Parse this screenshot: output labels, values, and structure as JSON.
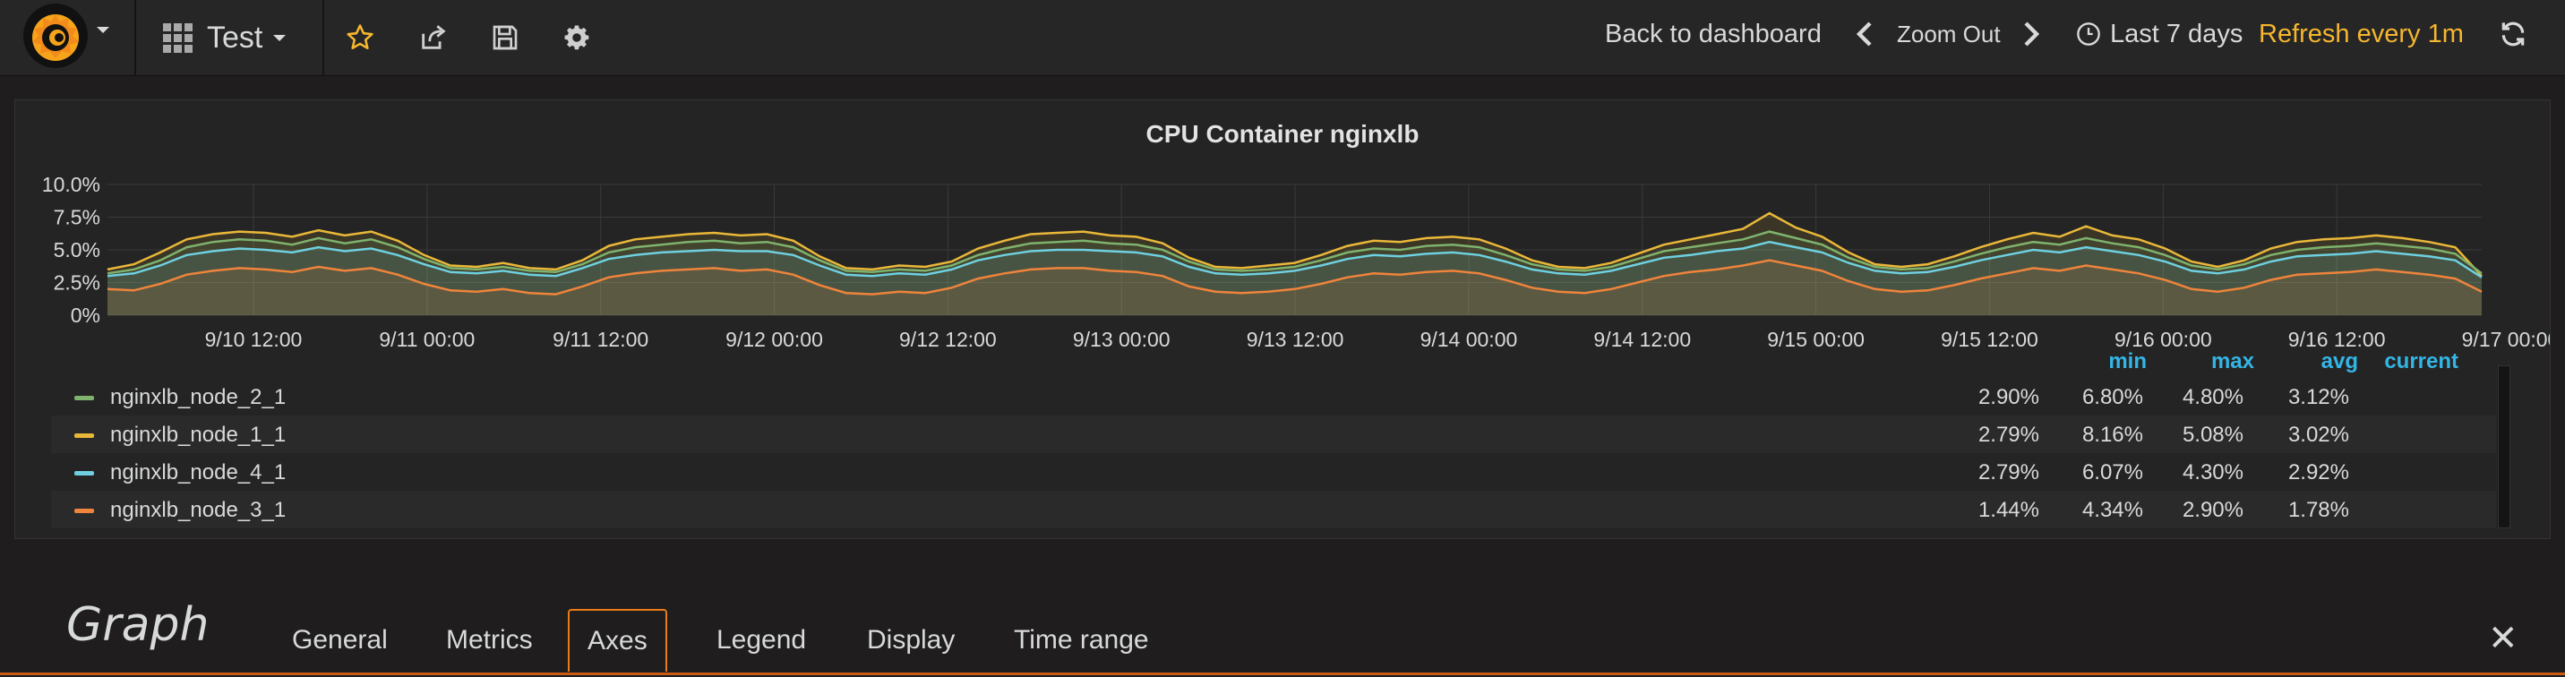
{
  "navbar": {
    "dashboard_title": "Test",
    "back_to_dashboard": "Back to dashboard",
    "zoom_out": "Zoom Out",
    "time_range": "Last 7 days",
    "refresh": "Refresh every 1m"
  },
  "panel": {
    "title": "CPU Container nginxlb"
  },
  "chart_data": {
    "type": "area",
    "title": "CPU Container nginxlb",
    "y_ticks": [
      "10.0%",
      "7.5%",
      "5.0%",
      "2.5%",
      "0%"
    ],
    "ylim": [
      0,
      10
    ],
    "x_ticks": [
      "9/10 12:00",
      "9/11 00:00",
      "9/11 12:00",
      "9/12 00:00",
      "9/12 12:00",
      "9/13 00:00",
      "9/13 12:00",
      "9/14 00:00",
      "9/14 12:00",
      "9/15 00:00",
      "9/15 12:00",
      "9/16 00:00",
      "9/16 12:00",
      "9/17 00:00"
    ],
    "grid": true,
    "legend_position": "bottom",
    "legend_columns": [
      "min",
      "max",
      "avg",
      "current"
    ],
    "series": [
      {
        "name": "nginxlb_node_2_1",
        "color": "#7eb26d",
        "min": "2.90%",
        "max": "6.80%",
        "avg": "4.80%",
        "current": "3.12%",
        "values": [
          3.2,
          3.5,
          4.2,
          5.2,
          5.6,
          5.8,
          5.7,
          5.4,
          5.9,
          5.5,
          5.8,
          5.2,
          4.3,
          3.6,
          3.5,
          3.7,
          3.4,
          3.3,
          3.9,
          4.8,
          5.2,
          5.4,
          5.6,
          5.7,
          5.5,
          5.6,
          5.2,
          4.2,
          3.4,
          3.3,
          3.5,
          3.4,
          3.8,
          4.6,
          5.1,
          5.5,
          5.6,
          5.7,
          5.5,
          5.4,
          5.0,
          4.1,
          3.5,
          3.4,
          3.5,
          3.7,
          4.2,
          4.8,
          5.1,
          5.0,
          5.3,
          5.4,
          5.2,
          4.6,
          3.9,
          3.5,
          3.4,
          3.7,
          4.3,
          4.9,
          5.2,
          5.5,
          5.8,
          6.4,
          5.9,
          5.4,
          4.4,
          3.7,
          3.5,
          3.6,
          4.1,
          4.7,
          5.2,
          5.6,
          5.4,
          5.9,
          5.5,
          5.2,
          4.6,
          3.8,
          3.5,
          3.9,
          4.6,
          5.0,
          5.2,
          5.3,
          5.5,
          5.3,
          5.1,
          4.7,
          3.2
        ]
      },
      {
        "name": "nginxlb_node_1_1",
        "color": "#eab839",
        "min": "2.79%",
        "max": "8.16%",
        "avg": "5.08%",
        "current": "3.02%",
        "values": [
          3.5,
          3.9,
          4.8,
          5.8,
          6.2,
          6.4,
          6.3,
          6.0,
          6.5,
          6.1,
          6.4,
          5.7,
          4.6,
          3.8,
          3.7,
          4.0,
          3.6,
          3.5,
          4.2,
          5.3,
          5.8,
          6.0,
          6.2,
          6.3,
          6.1,
          6.2,
          5.7,
          4.5,
          3.6,
          3.5,
          3.8,
          3.7,
          4.1,
          5.1,
          5.7,
          6.2,
          6.3,
          6.4,
          6.1,
          6.0,
          5.5,
          4.4,
          3.7,
          3.6,
          3.8,
          4.0,
          4.6,
          5.3,
          5.7,
          5.6,
          5.9,
          6.0,
          5.8,
          5.1,
          4.2,
          3.7,
          3.6,
          4.0,
          4.7,
          5.4,
          5.8,
          6.2,
          6.6,
          7.8,
          6.7,
          6.0,
          4.8,
          3.9,
          3.7,
          3.9,
          4.5,
          5.2,
          5.8,
          6.3,
          6.0,
          6.8,
          6.1,
          5.8,
          5.1,
          4.1,
          3.7,
          4.2,
          5.1,
          5.6,
          5.8,
          5.9,
          6.1,
          5.9,
          5.6,
          5.2,
          3.0
        ]
      },
      {
        "name": "nginxlb_node_4_1",
        "color": "#6ed0e0",
        "min": "2.79%",
        "max": "6.07%",
        "avg": "4.30%",
        "current": "2.92%",
        "values": [
          3.0,
          3.2,
          3.8,
          4.6,
          4.9,
          5.1,
          5.0,
          4.8,
          5.2,
          4.9,
          5.1,
          4.6,
          3.9,
          3.3,
          3.2,
          3.4,
          3.1,
          3.0,
          3.6,
          4.3,
          4.6,
          4.8,
          4.9,
          5.0,
          4.9,
          4.9,
          4.6,
          3.8,
          3.1,
          3.0,
          3.2,
          3.1,
          3.5,
          4.2,
          4.6,
          4.9,
          5.0,
          5.0,
          4.9,
          4.8,
          4.5,
          3.7,
          3.2,
          3.1,
          3.2,
          3.4,
          3.8,
          4.3,
          4.6,
          4.5,
          4.7,
          4.8,
          4.6,
          4.1,
          3.5,
          3.2,
          3.1,
          3.4,
          3.9,
          4.4,
          4.6,
          4.9,
          5.1,
          5.6,
          5.2,
          4.8,
          4.0,
          3.4,
          3.2,
          3.3,
          3.7,
          4.2,
          4.6,
          5.0,
          4.8,
          5.2,
          4.9,
          4.6,
          4.1,
          3.4,
          3.2,
          3.5,
          4.1,
          4.5,
          4.6,
          4.7,
          4.9,
          4.7,
          4.5,
          4.2,
          2.9
        ]
      },
      {
        "name": "nginxlb_node_3_1",
        "color": "#ef843c",
        "min": "1.44%",
        "max": "4.34%",
        "avg": "2.90%",
        "current": "1.78%",
        "values": [
          2.0,
          1.9,
          2.4,
          3.1,
          3.4,
          3.6,
          3.5,
          3.3,
          3.7,
          3.4,
          3.6,
          3.1,
          2.4,
          1.9,
          1.8,
          2.0,
          1.7,
          1.6,
          2.2,
          2.9,
          3.2,
          3.4,
          3.5,
          3.6,
          3.4,
          3.5,
          3.1,
          2.3,
          1.7,
          1.6,
          1.8,
          1.7,
          2.1,
          2.8,
          3.2,
          3.5,
          3.6,
          3.6,
          3.4,
          3.3,
          3.0,
          2.2,
          1.8,
          1.7,
          1.8,
          2.0,
          2.4,
          2.9,
          3.2,
          3.1,
          3.3,
          3.4,
          3.2,
          2.7,
          2.1,
          1.8,
          1.7,
          2.0,
          2.5,
          3.0,
          3.3,
          3.5,
          3.8,
          4.2,
          3.8,
          3.4,
          2.6,
          2.0,
          1.8,
          1.9,
          2.3,
          2.8,
          3.2,
          3.6,
          3.4,
          3.8,
          3.5,
          3.2,
          2.7,
          2.0,
          1.8,
          2.1,
          2.7,
          3.1,
          3.2,
          3.3,
          3.5,
          3.3,
          3.1,
          2.8,
          1.8
        ]
      }
    ]
  },
  "editor": {
    "title": "Graph",
    "tabs": [
      "General",
      "Metrics",
      "Axes",
      "Legend",
      "Display",
      "Time range"
    ],
    "active_tab": "Axes"
  },
  "colors": {
    "accent": "#eb7b18",
    "refresh": "#f6b62f",
    "legend_header": "#33b5e5"
  }
}
